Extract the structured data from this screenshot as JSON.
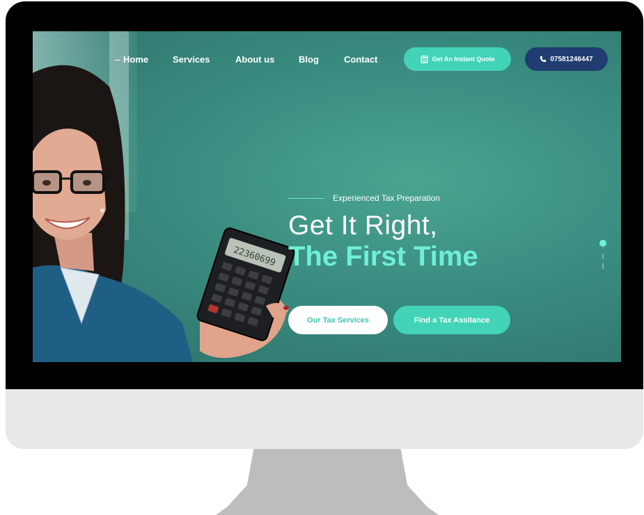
{
  "nav": {
    "items": [
      {
        "label": "Home",
        "active": true
      },
      {
        "label": "Services"
      },
      {
        "label": "About us"
      },
      {
        "label": "Blog"
      },
      {
        "label": "Contact"
      }
    ],
    "quote_button": "Get An Instant Quote",
    "phone_button": "07581246447"
  },
  "hero": {
    "kicker": "Experienced Tax Preparation",
    "title_line1": "Get It Right,",
    "title_line2": "The First Time",
    "primary_button": "Our Tax Services",
    "secondary_button": "Find a Tax Assitance"
  },
  "calculator": {
    "display": "22360699"
  },
  "slider": {
    "slide_count": 3,
    "active_index": 0
  },
  "colors": {
    "accent": "#43d3b8",
    "title_accent": "#6ff0d4",
    "phone_button_bg": "#203c70",
    "hero_bg": "#3a8c80"
  },
  "icons": {
    "quote_icon": "calculator-icon",
    "phone_icon": "phone-icon"
  }
}
